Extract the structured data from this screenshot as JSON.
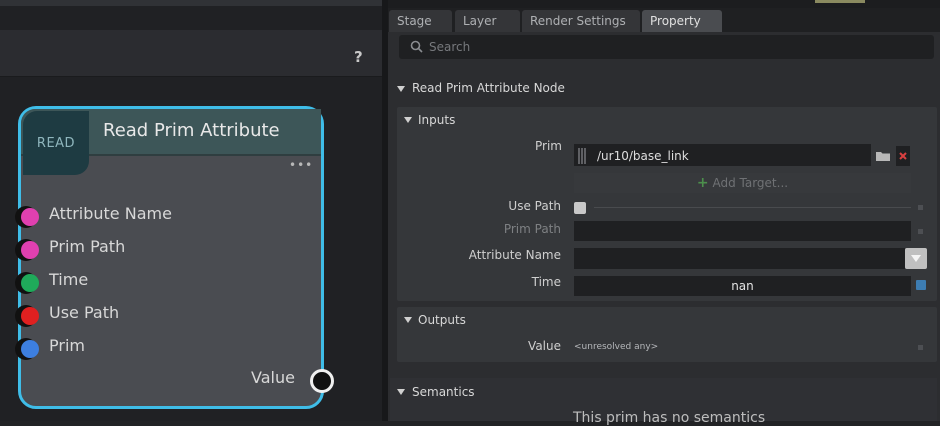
{
  "graph": {
    "help_icon": "?",
    "node": {
      "badge": "READ",
      "title": "Read Prim Attribute",
      "ellipsis": "•••",
      "inputs": [
        {
          "label": "Attribute Name",
          "color": "#e040b0"
        },
        {
          "label": "Prim Path",
          "color": "#e040b0"
        },
        {
          "label": "Time",
          "color": "#1faa5a"
        },
        {
          "label": "Use Path",
          "color": "#e02020"
        },
        {
          "label": "Prim",
          "color": "#3d7fe0"
        }
      ],
      "output": {
        "label": "Value"
      }
    }
  },
  "panel": {
    "tabs": [
      "Stage",
      "Layer",
      "Render Settings",
      "Property"
    ],
    "active_tab": "Property",
    "search": {
      "placeholder": "Search",
      "icon": "search-icon"
    },
    "section_title": "Read Prim Attribute Node",
    "inputs": {
      "title": "Inputs",
      "prim_label": "Prim",
      "prim_value": "/ur10/base_link",
      "add_target": "Add Target...",
      "add_target_icon": "+",
      "use_path_label": "Use Path",
      "prim_path_label": "Prim Path",
      "attribute_name_label": "Attribute Name",
      "time_label": "Time",
      "time_value": "nan"
    },
    "outputs": {
      "title": "Outputs",
      "value_label": "Value",
      "value": "<unresolved any>"
    },
    "semantics": {
      "title": "Semantics",
      "message": "This prim has no semantics"
    }
  }
}
